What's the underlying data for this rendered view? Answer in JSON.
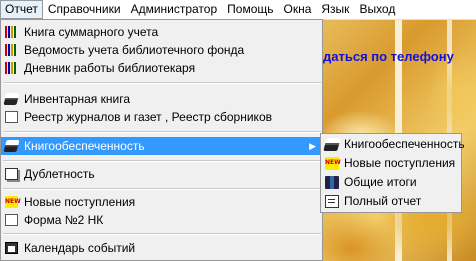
{
  "menubar": {
    "items": [
      "Отчет",
      "Справочники",
      "Администратор",
      "Помощь",
      "Окна",
      "Язык",
      "Выход"
    ]
  },
  "background_text": "даться по телефону",
  "menu": {
    "items": [
      {
        "label": "Книга суммарного учета",
        "icon": "books-icon"
      },
      {
        "label": "Ведомость учета библиотечного фонда",
        "icon": "books-icon"
      },
      {
        "label": "Дневник работы библиотекаря",
        "icon": "books-icon"
      },
      {
        "label": "Инвентарная книга",
        "icon": "open-book-icon"
      },
      {
        "label": "Реестр журналов и газет , Реестр сборников",
        "icon": "document-icon"
      },
      {
        "label": "Книгообеспеченность",
        "icon": "open-book-icon",
        "submenu": true
      },
      {
        "label": "Дублетность",
        "icon": "duplicate-icon"
      },
      {
        "label": "Новые поступления",
        "icon": "new-icon"
      },
      {
        "label": "Форма №2 НК",
        "icon": "document-icon"
      },
      {
        "label": "Календарь событий",
        "icon": "calendar-icon"
      }
    ]
  },
  "submenu": {
    "items": [
      {
        "label": "Книгообеспеченность",
        "icon": "open-book-icon"
      },
      {
        "label": "Новые поступления",
        "icon": "new-icon"
      },
      {
        "label": "Общие итоги",
        "icon": "summary-icon"
      },
      {
        "label": "Полный отчет",
        "icon": "full-report-icon"
      }
    ]
  },
  "icons": {
    "new_badge": "NEW"
  },
  "colors": {
    "highlight": "#3399ff",
    "phone_text": "#1010e0"
  }
}
